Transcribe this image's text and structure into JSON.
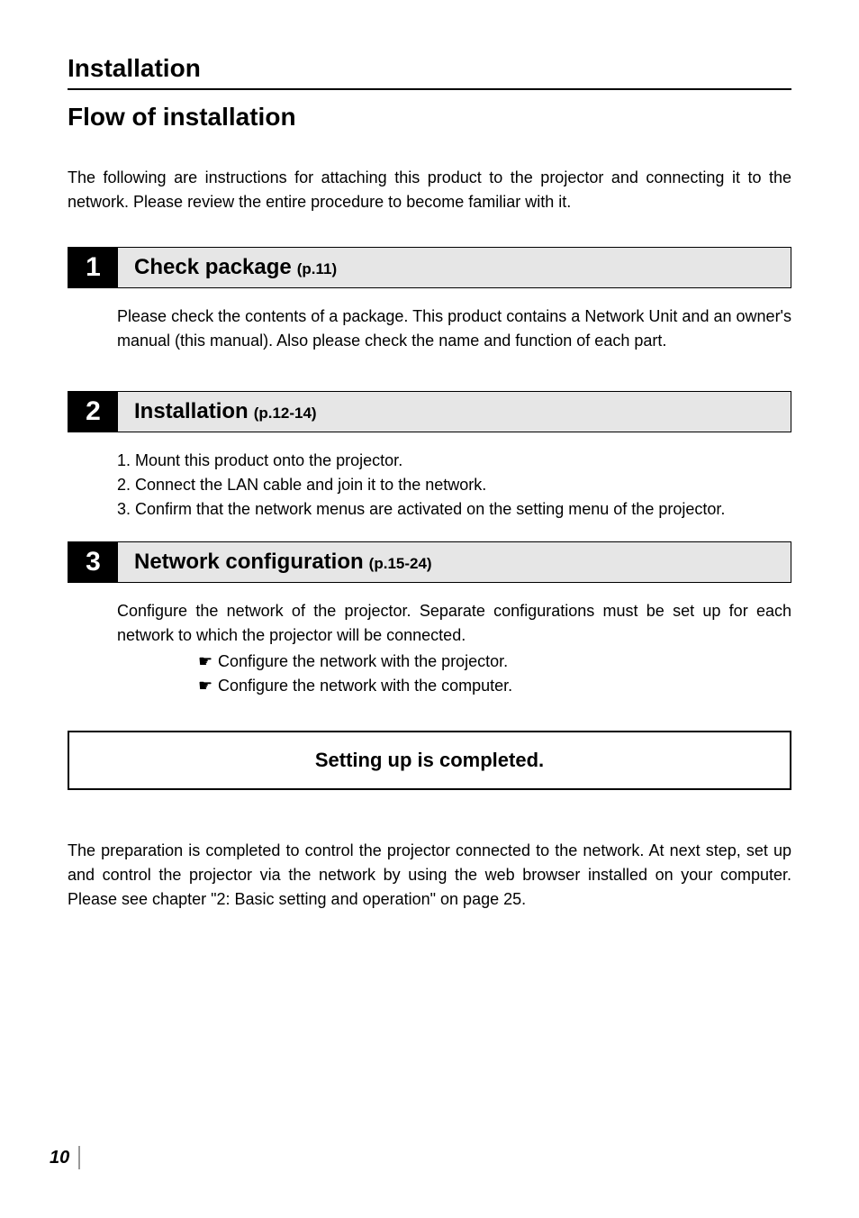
{
  "header": {
    "title": "Installation",
    "subtitle": "Flow of installation"
  },
  "intro": "The following are instructions for attaching this product to the projector and connecting it to the network. Please review the entire procedure to become familiar with it.",
  "steps": [
    {
      "number": "1",
      "title": "Check package",
      "pageRef": "(p.11)",
      "body": "Please check the contents of a package. This product contains a Network Unit and an owner's manual (this manual). Also please check the name and function of each part."
    },
    {
      "number": "2",
      "title": "Installation",
      "pageRef": "(p.12-14)",
      "list": [
        "1. Mount this product onto the projector.",
        "2. Connect the LAN cable and join it to the network.",
        "3. Confirm that the network menus are activated on the setting menu of the projector."
      ]
    },
    {
      "number": "3",
      "title": "Network configuration",
      "pageRef": "(p.15-24)",
      "body": "Configure the network of the projector. Separate configurations must be set up for each network to which the projector will be connected.",
      "bullets": [
        "Configure the network with the projector.",
        "Configure the network with the computer."
      ]
    }
  ],
  "completion": "Setting up is completed.",
  "outro": "The preparation is completed to control the projector connected to the network. At next step, set up and control the projector via the network by using the web browser installed on your computer. Please see chapter \"2: Basic setting and operation\" on page 25.",
  "pageNumber": "10"
}
